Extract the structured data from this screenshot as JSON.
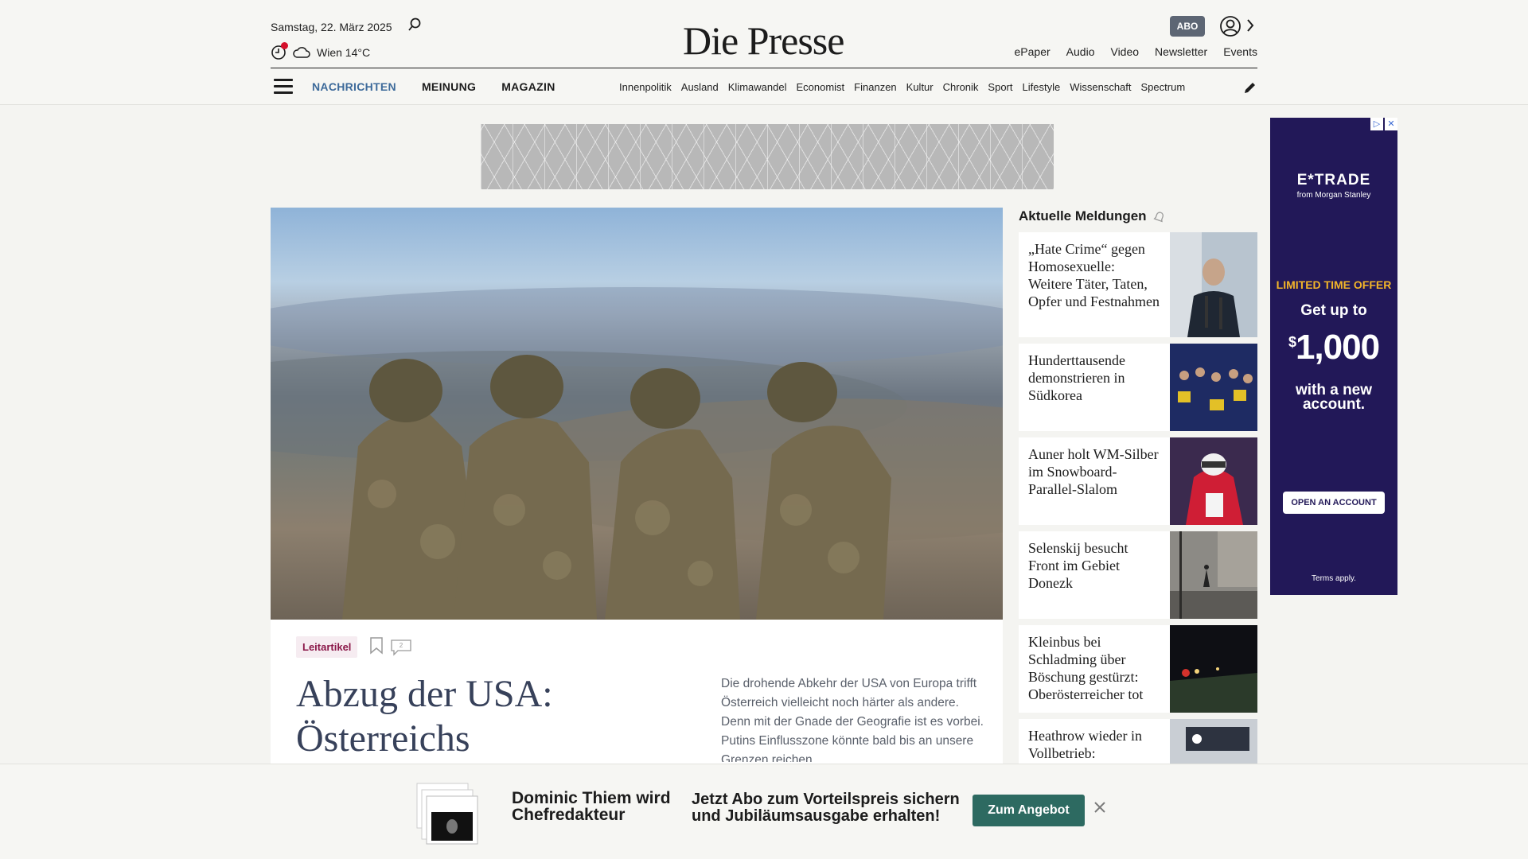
{
  "header": {
    "date": "Samstag, 22. März 2025",
    "weather": "Wien 14°C",
    "logo": "Die Presse",
    "abo_label": "ABO",
    "top_links": [
      "ePaper",
      "Audio",
      "Video",
      "Newsletter",
      "Events"
    ]
  },
  "nav": {
    "main": [
      "NACHRICHTEN",
      "MEINUNG",
      "MAGAZIN"
    ],
    "sub": [
      "Innenpolitik",
      "Ausland",
      "Klimawandel",
      "Economist",
      "Finanzen",
      "Kultur",
      "Chronik",
      "Sport",
      "Lifestyle",
      "Wissenschaft",
      "Spectrum"
    ]
  },
  "hero": {
    "tag": "Leitartikel",
    "comment_count": "2",
    "title": "Abzug der USA: Österreichs",
    "teaser": "Die drohende Abkehr der USA von Europa trifft Österreich vielleicht noch härter als andere. Denn mit der Gnade der Geografie ist es vorbei. Putins Einflusszone könnte bald bis an unsere Grenzen reichen."
  },
  "sidebar": {
    "title": "Aktuelle Meldungen",
    "items": [
      {
        "title": "„Hate Crime“ gegen Homosexuelle: Weitere Täter, Taten, Opfer und Festnahmen"
      },
      {
        "title": "Hunderttausende demonstrieren in Südkorea"
      },
      {
        "title": "Auner holt WM-Silber im Snowboard-Parallel-Slalom"
      },
      {
        "title": "Selenskij besucht Front im Gebiet Donezk"
      },
      {
        "title": "Kleinbus bei Schladming über Böschung gestürzt: Oberösterreicher tot"
      },
      {
        "title": "Heathrow wieder in Vollbetrieb:"
      }
    ]
  },
  "ad": {
    "brand": "E*TRADE",
    "brand_sub": "from Morgan Stanley",
    "offer": "LIMITED TIME OFFER",
    "get": "Get up to",
    "amount": "1,000",
    "currency": "$",
    "with": "with a new account.",
    "button": "OPEN AN ACCOUNT",
    "terms": "Terms apply."
  },
  "banner": {
    "name": "Dominic Thiem wird Chefredakteur",
    "offer": "Jetzt Abo zum Vorteilspreis sichern und Jubiläumsausgabe erhalten!",
    "button": "Zum Angebot"
  },
  "colors": {
    "accent_nav": "#3d6a9a",
    "tag": "#8b1849",
    "cta": "#2d6a61",
    "ad_bg": "#221858",
    "ad_offer": "#f3b529"
  }
}
